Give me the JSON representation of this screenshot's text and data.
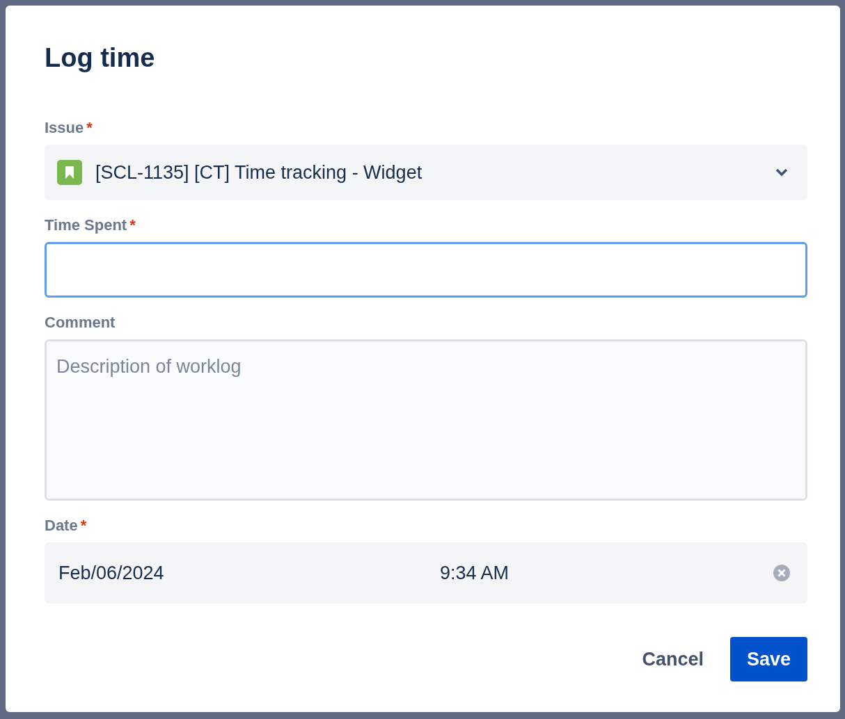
{
  "dialog": {
    "title": "Log time",
    "fields": [
      {
        "kind": "select",
        "label": "Issue",
        "required_mark": "*",
        "value": "[SCL-1135] [CT] Time tracking - Widget"
      },
      {
        "kind": "text",
        "label": "Time Spent",
        "required_mark": "*",
        "focused": true
      },
      {
        "kind": "textarea",
        "label": "Comment",
        "placeholder": "Description of worklog"
      },
      {
        "kind": "datetime",
        "label": "Date",
        "required_mark": "*",
        "date": "Feb/06/2024",
        "time": "9:34 AM"
      }
    ],
    "buttons": [
      {
        "label": "Cancel",
        "kind": "subtle"
      },
      {
        "label": "Save",
        "kind": "primary"
      }
    ]
  }
}
